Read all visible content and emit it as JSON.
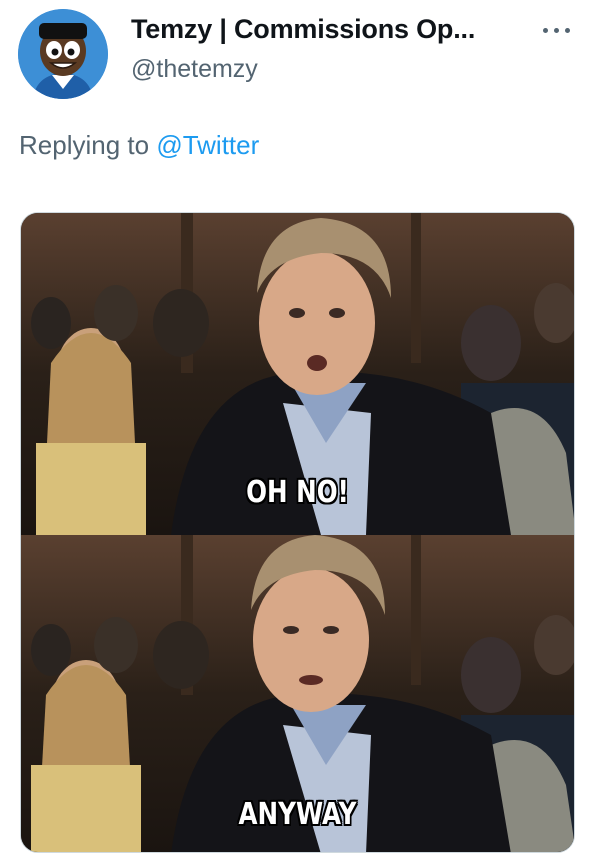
{
  "tweet": {
    "author": {
      "display_name": "Temzy | Commissions Op...",
      "handle": "@thetemzy",
      "avatar_icon": "cartoon-avatar-icon"
    },
    "more_icon": "more-horizontal-icon",
    "replying_prefix": "Replying to",
    "replying_to": "@Twitter",
    "media": {
      "type": "meme-image",
      "panels": [
        {
          "caption": "OH NO!"
        },
        {
          "caption": "ANYWAY"
        }
      ]
    }
  },
  "colors": {
    "name": "#0f1419",
    "secondary": "#536471",
    "link": "#1d9bf0",
    "avatar_bg": "#3d8fd6"
  }
}
